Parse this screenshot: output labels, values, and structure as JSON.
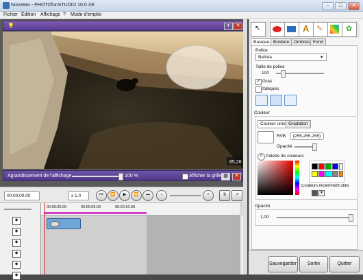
{
  "window": {
    "title": "Nouveau - PHOTOfunSTUDIO 10.0 XE",
    "min": "–",
    "max": "□",
    "close": "✕"
  },
  "menu": {
    "items": [
      "Fichier",
      "Édition",
      "Affichage",
      "?",
      "Mode d'emploi"
    ]
  },
  "preview": {
    "header_min": "▾",
    "header_close": "✕",
    "corner_badge": "85,26",
    "zoom_label": "Agrandissement de l'affichage",
    "zoom_value": "100 %",
    "grid_label": "Afficher la grille"
  },
  "transport": {
    "timecode": "00:00:00.00",
    "speed": "x 1.0",
    "buttons": [
      "⏮",
      "⏪",
      "▶",
      "⏩",
      "⏭"
    ]
  },
  "timeline": {
    "ticks": [
      "00:00:00.00",
      "00:00:05.00",
      "00:00:10.00"
    ],
    "track_icons": [
      "◆",
      "◆",
      "◆",
      "◆",
      "◆",
      "◆"
    ]
  },
  "tabs": [
    "Basique",
    "Bordure",
    "Ombres",
    "Fond"
  ],
  "font": {
    "section": "Police",
    "family": "Bellota",
    "size_label": "Taille de police",
    "size_value": "100",
    "bold_label": "Gras",
    "italic_label": "Italiques"
  },
  "color": {
    "section": "Couleur",
    "tab_solid": "Couleur unie",
    "tab_gradient": "Gradation",
    "rgb_label": "RVB",
    "rgb_value": "(255,255,255)",
    "opacity_label": "Opacité",
    "palette_label": "Palette de couleurs",
    "recent_label": "Couleurs récemment utilis",
    "swatches": [
      "#000000",
      "#ff0000",
      "#00aa00",
      "#0000ff",
      "#ffffff",
      "#ffff00",
      "#ff00ff",
      "#00ffff",
      "#888888",
      "#ff8800"
    ]
  },
  "opacity": {
    "label": "Opacité",
    "value": "1,00"
  },
  "buttons": {
    "save": "Sauvegarder",
    "exit": "Sortie",
    "quit": "Quitter"
  }
}
